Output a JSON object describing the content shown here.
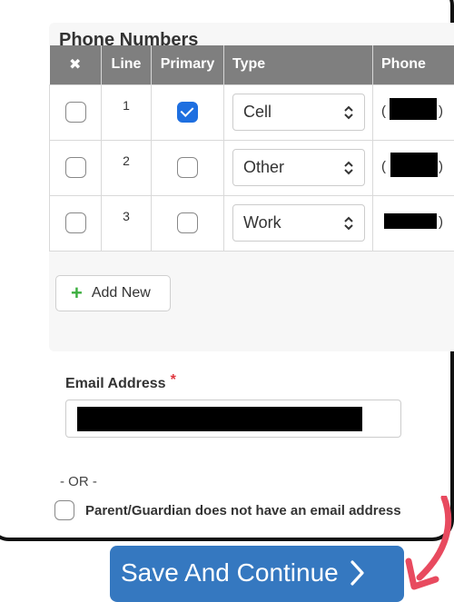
{
  "phone_section": {
    "title": "Phone Numbers",
    "columns": {
      "delete_icon": "✖",
      "line": "Line",
      "primary": "Primary",
      "type": "Type",
      "phone": "Phone"
    },
    "rows": [
      {
        "line": "1",
        "primary": true,
        "type": "Cell",
        "phone_prefix": "(",
        "phone_suffix": ")"
      },
      {
        "line": "2",
        "primary": false,
        "type": "Other",
        "phone_prefix": "(",
        "phone_suffix": ")"
      },
      {
        "line": "3",
        "primary": false,
        "type": "Work",
        "phone_prefix": "",
        "phone_suffix": ")"
      }
    ],
    "add_new_icon": "+",
    "add_new_label": "Add New"
  },
  "email": {
    "label": "Email Address",
    "required_marker": "*",
    "or_text": "- OR -",
    "no_email_label": "Parent/Guardian does not have an email address",
    "no_email_checked": false
  },
  "footer": {
    "save_label": "Save And Continue",
    "save_icon": "chevron-right-icon"
  },
  "colors": {
    "header_bg": "#7f7f7f",
    "checkbox_checked": "#1e6fe0",
    "add_icon": "#3cae3f",
    "required": "#e0373f",
    "save_button": "#3578c0",
    "annotation_arrow": "#e84a5f"
  }
}
